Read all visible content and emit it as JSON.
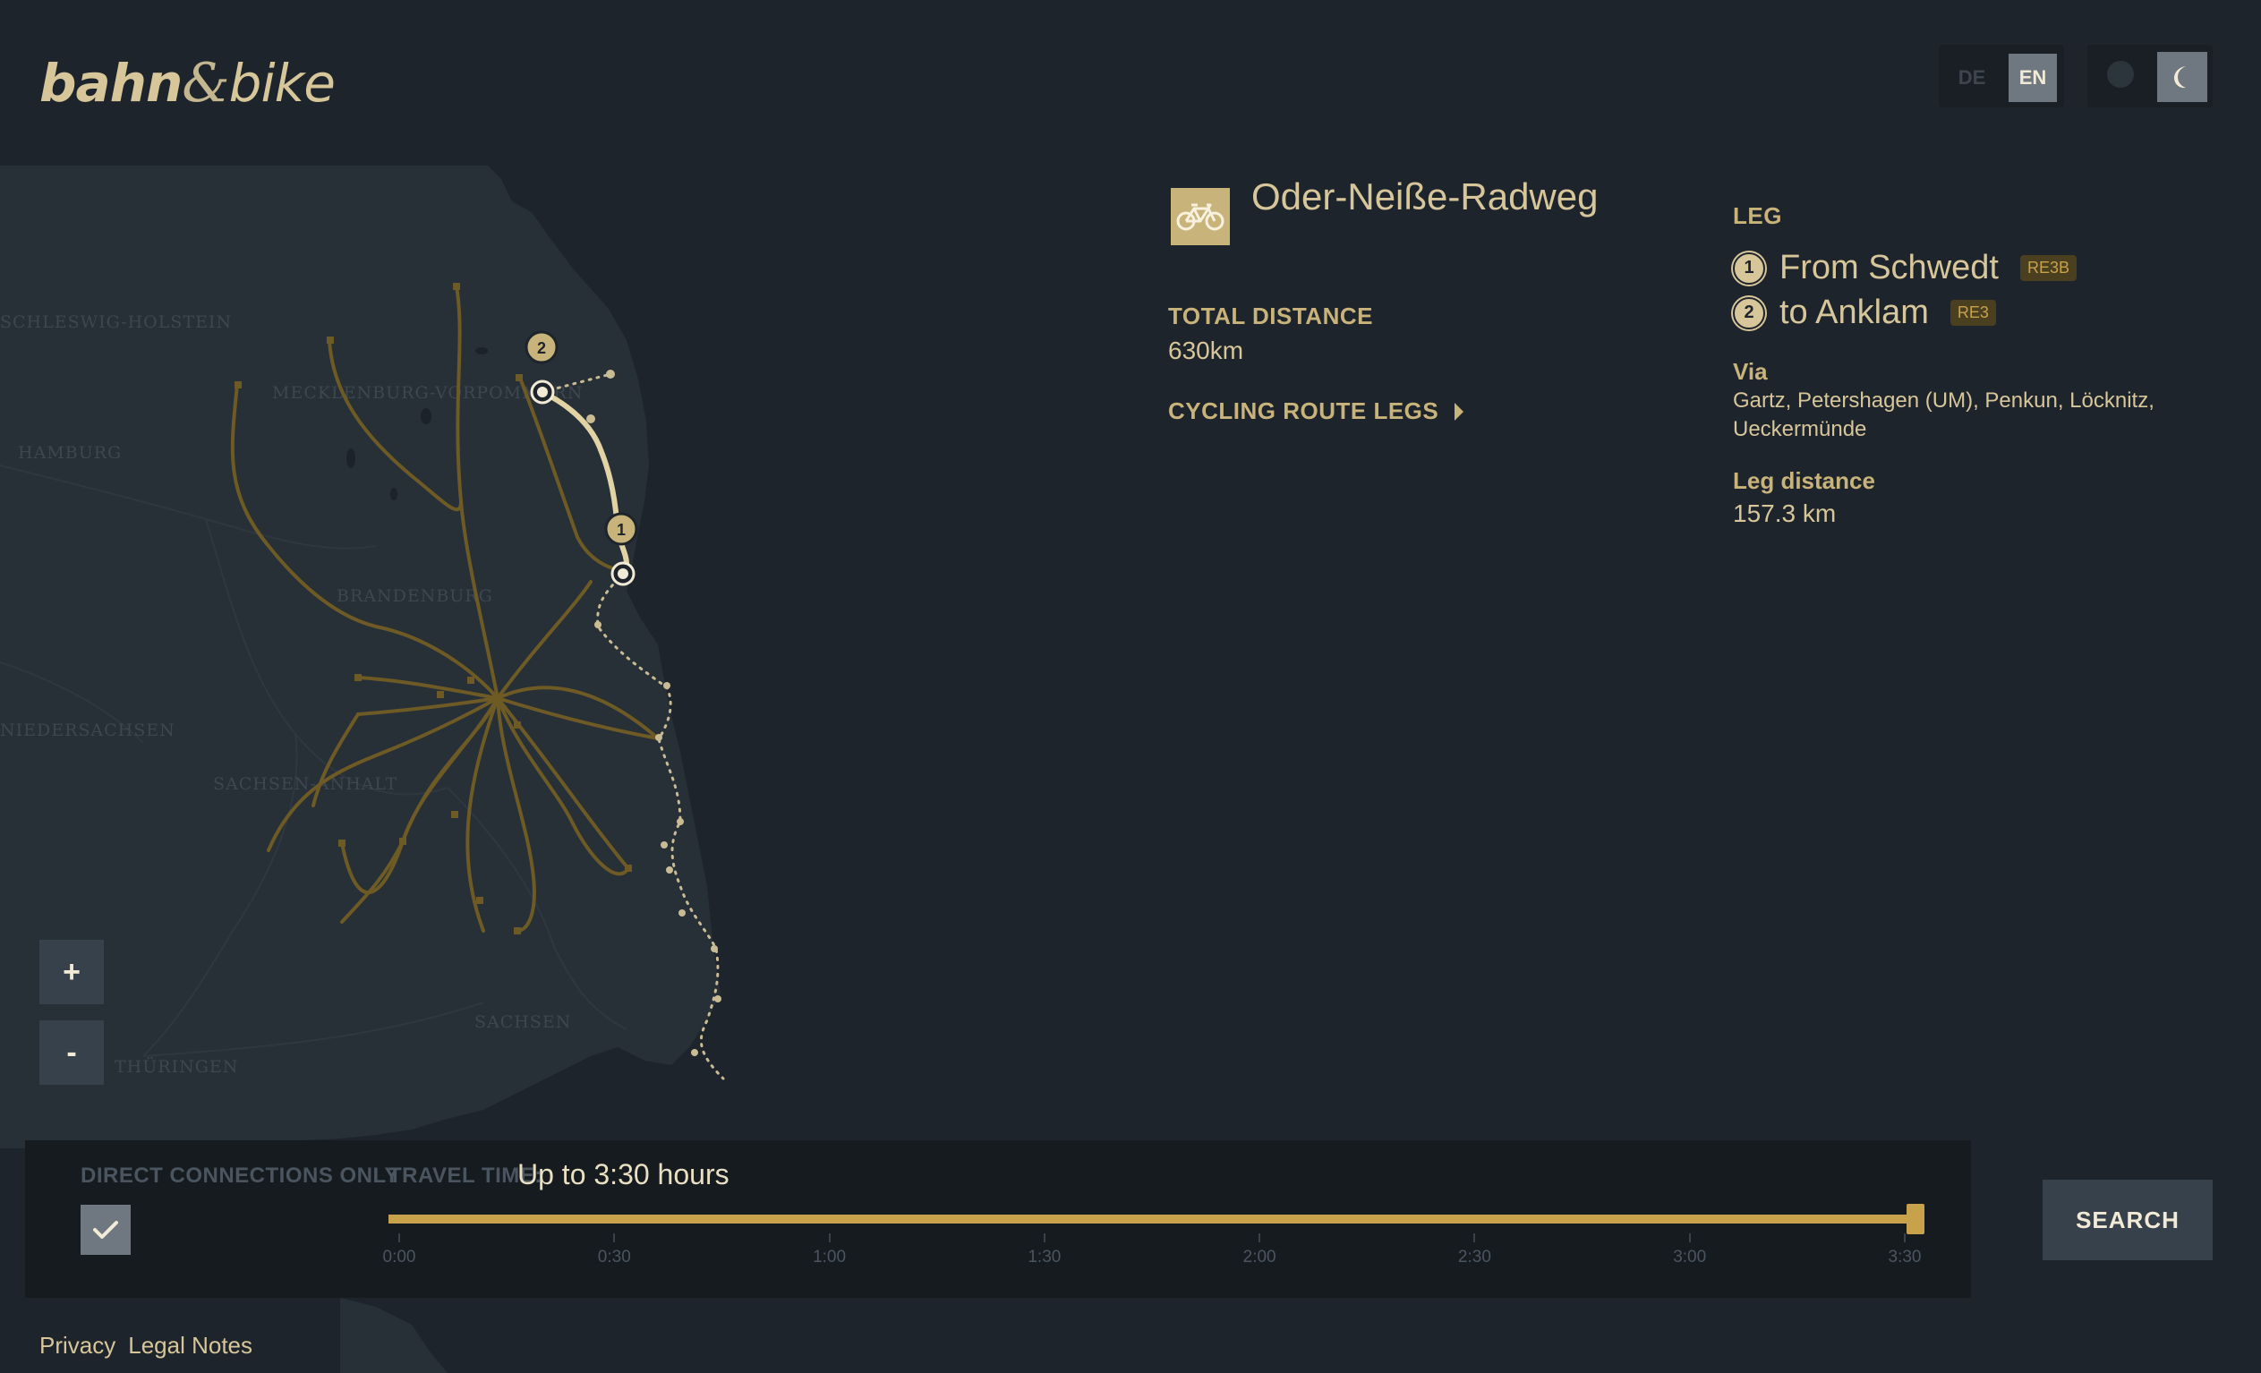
{
  "app": {
    "logo_left": "bahn",
    "logo_amp": "&",
    "logo_right": "bike"
  },
  "header": {
    "lang_de": "DE",
    "lang_en": "EN",
    "active_lang": "EN",
    "theme": "dark"
  },
  "map": {
    "regions": [
      "SCHLESWIG-HOLSTEIN",
      "MECKLENBURG-VORPOMMERN",
      "HAMBURG",
      "BRANDENBURG",
      "SACHSEN-ANHALT",
      "NIEDERSACHSEN",
      "SACHSEN",
      "THÜRINGEN"
    ],
    "markers": [
      "1",
      "2"
    ],
    "zoom_in": "+",
    "zoom_out": "-"
  },
  "route": {
    "icon": "bicycle-icon",
    "title": "Oder-Neiße-Radweg",
    "total_distance_label": "TOTAL DISTANCE",
    "total_distance_value": "630km",
    "legs_link": "CYCLING ROUTE LEGS"
  },
  "leg": {
    "label": "LEG",
    "from_num": "1",
    "from_text": "From Schwedt",
    "from_train": "RE3B",
    "to_num": "2",
    "to_text": "to Anklam",
    "to_train": "RE3",
    "via_label": "Via",
    "via_value": "Gartz, Petershagen (UM), Penkun, Löcknitz, Ueckermünde",
    "distance_label": "Leg distance",
    "distance_value": "157.3 km"
  },
  "filters": {
    "direct_label": "DIRECT CONNECTIONS ONLY",
    "direct_checked": true,
    "travel_label": "TRAVEL TIME:",
    "travel_value": "Up to 3:30 hours",
    "travel_fraction": 1.0,
    "ticks": [
      "0:00",
      "0:30",
      "1:00",
      "1:30",
      "2:00",
      "2:30",
      "3:00",
      "3:30"
    ]
  },
  "search": {
    "label": "SEARCH"
  },
  "footer": {
    "privacy": "Privacy",
    "legal": "Legal Notes"
  },
  "colors": {
    "background": "#1e242b",
    "accent": "#c8b37a",
    "route_highlight": "#e2d3a4",
    "network": "#6e5a24"
  }
}
